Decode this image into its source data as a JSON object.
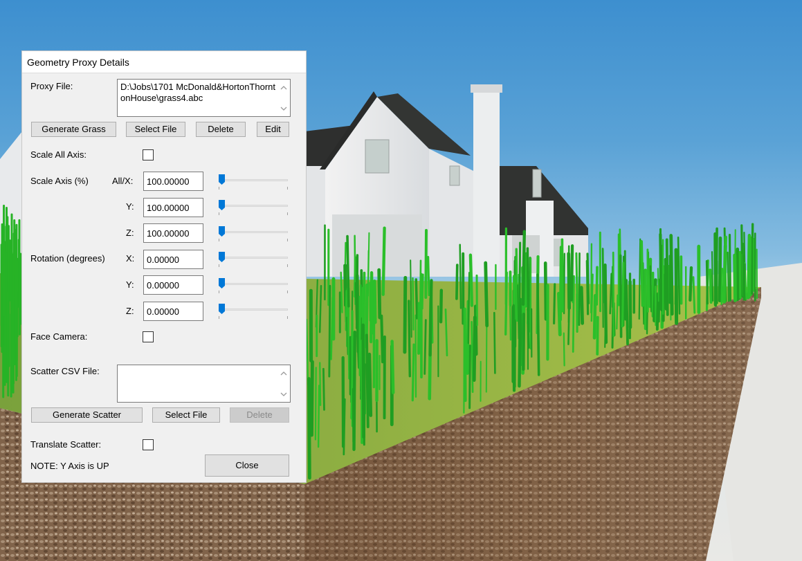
{
  "scene": {
    "description_icon": "3d-viewport"
  },
  "dialog": {
    "title": "Geometry Proxy Details",
    "proxy_file_label": "Proxy File:",
    "proxy_file_value": "D:\\Jobs\\1701 McDonald&HortonThorntonHouse\\grass4.abc",
    "buttons": {
      "generate_grass": "Generate Grass",
      "select_file": "Select File",
      "delete": "Delete",
      "edit": "Edit",
      "generate_scatter": "Generate Scatter",
      "select_file_scatter": "Select File",
      "delete_scatter": "Delete",
      "close": "Close"
    },
    "scale_all_axis_label": "Scale All Axis:",
    "scale_all_axis_checked": false,
    "scale_axis_label": "Scale Axis (%)",
    "rotation_label": "Rotation (degrees)",
    "axis_labels": {
      "all_x": "All/X:",
      "y": "Y:",
      "z": "Z:",
      "x": "X:"
    },
    "scale": {
      "x": "100.00000",
      "y": "100.00000",
      "z": "100.00000"
    },
    "rotation": {
      "x": "0.00000",
      "y": "0.00000",
      "z": "0.00000"
    },
    "slider_levels": {
      "scale_x": 0,
      "scale_y": 0,
      "scale_z": 0,
      "rot_x": 0,
      "rot_y": 0,
      "rot_z": 0
    },
    "face_camera_label": "Face Camera:",
    "face_camera_checked": false,
    "scatter_csv_label": "Scatter CSV File:",
    "scatter_csv_value": "",
    "translate_scatter_label": "Translate Scatter:",
    "translate_scatter_checked": false,
    "note": "NOTE: Y Axis is UP"
  },
  "colors": {
    "accent": "#0078d7",
    "grass": "#2fb82a",
    "soil": "#7a5a3e"
  }
}
